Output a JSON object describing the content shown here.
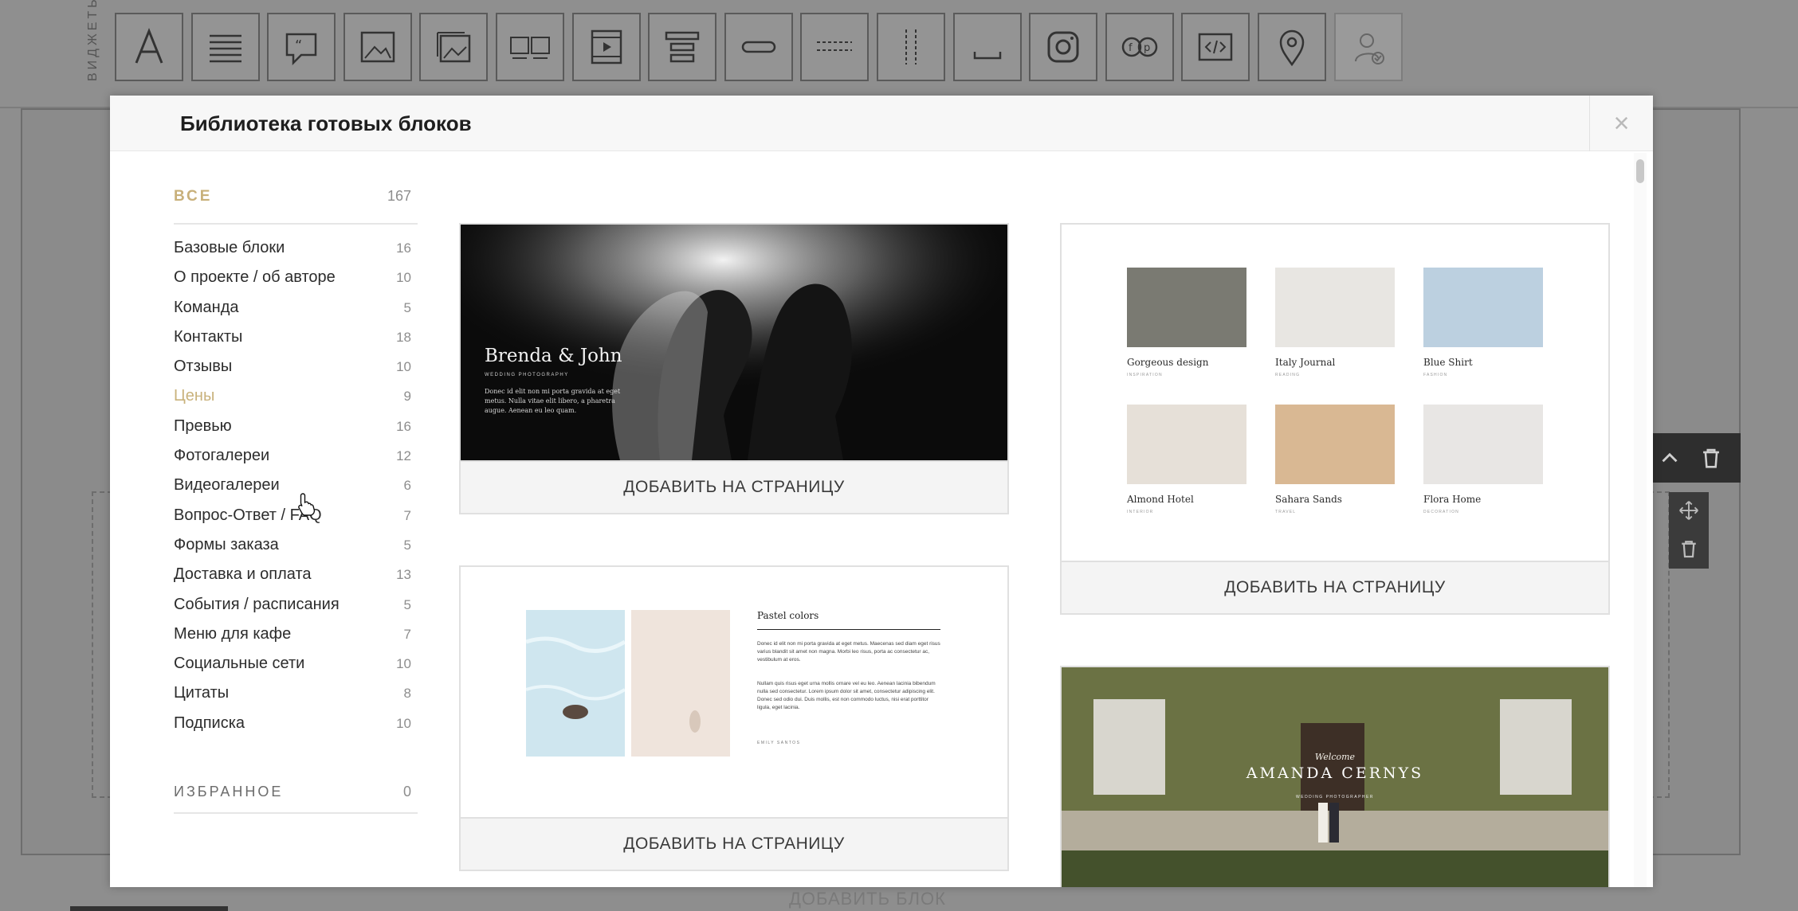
{
  "widget_bar": {
    "label": "ВИДЖЕТЫ",
    "tiles": [
      {
        "icon": "text-a-icon"
      },
      {
        "icon": "paragraph-icon"
      },
      {
        "icon": "quote-icon"
      },
      {
        "icon": "image-icon"
      },
      {
        "icon": "gallery-icon"
      },
      {
        "icon": "image-row-icon"
      },
      {
        "icon": "video-icon"
      },
      {
        "icon": "layout-blocks-icon"
      },
      {
        "icon": "button-icon"
      },
      {
        "icon": "divider-dashed-icon"
      },
      {
        "icon": "vertical-divider-icon"
      },
      {
        "icon": "spacer-icon"
      },
      {
        "icon": "instagram-icon"
      },
      {
        "icon": "social-icon"
      },
      {
        "icon": "code-icon"
      },
      {
        "icon": "map-pin-icon"
      },
      {
        "icon": "user-check-icon"
      }
    ]
  },
  "bottom": {
    "add_block_label": "ДОБАВИТЬ БЛОК"
  },
  "modal": {
    "title": "Библиотека готовых блоков",
    "close_label": "×",
    "all": {
      "label": "ВСЕ",
      "count": "167"
    },
    "categories": [
      {
        "label": "Базовые блоки",
        "count": "16"
      },
      {
        "label": "О проекте / об авторе",
        "count": "10"
      },
      {
        "label": "Команда",
        "count": "5"
      },
      {
        "label": "Контакты",
        "count": "18"
      },
      {
        "label": "Отзывы",
        "count": "10"
      },
      {
        "label": "Цены",
        "count": "9"
      },
      {
        "label": "Превью",
        "count": "16"
      },
      {
        "label": "Фотогалереи",
        "count": "12"
      },
      {
        "label": "Видеогалереи",
        "count": "6"
      },
      {
        "label": "Вопрос-Ответ / FAQ",
        "count": "7"
      },
      {
        "label": "Формы заказа",
        "count": "5"
      },
      {
        "label": "Доставка и оплата",
        "count": "13"
      },
      {
        "label": "События / расписания",
        "count": "5"
      },
      {
        "label": "Меню для кафе",
        "count": "7"
      },
      {
        "label": "Социальные сети",
        "count": "10"
      },
      {
        "label": "Цитаты",
        "count": "8"
      },
      {
        "label": "Подписка",
        "count": "10"
      }
    ],
    "favorites": {
      "label": "ИЗБРАННОЕ",
      "count": "0"
    },
    "add_label": "ДОБАВИТЬ НА СТРАНИЦУ",
    "cards": {
      "c1": {
        "title": "Brenda & John",
        "subtitle": "WEDDING PHOTOGRAPHY",
        "body": "Donec id elit non mi porta gravida at eget metus. Nulla vitae elit libero, a pharetra augue. Aenean eu leo quam."
      },
      "c2": {
        "items": [
          {
            "title": "Gorgeous design",
            "tag": "INSPIRATION"
          },
          {
            "title": "Italy Journal",
            "tag": "READING"
          },
          {
            "title": "Blue Shirt",
            "tag": "FASHION"
          },
          {
            "title": "Almond Hotel",
            "tag": "INTERIOR"
          },
          {
            "title": "Sahara Sands",
            "tag": "TRAVEL"
          },
          {
            "title": "Flora Home",
            "tag": "DECORATION"
          }
        ]
      },
      "c3": {
        "title": "Pastel colors",
        "text1": "Donec id elit non mi porta gravida at eget metus. Maecenas sed diam eget risus varius blandit sit amet non magna. Morbi leo risus, porta ac consectetur ac, vestibulum at eros.",
        "text2": "Nullam quis risus eget urna mollis ornare vel eu leo. Aenean lacinia bibendum nulla sed consectetur. Lorem ipsum dolor sit amet, consectetur adipiscing elit. Donec sed odio dui. Duis mollis, est non commodo luctus, nisi erat porttitor ligula, eget lacinia.",
        "author": "EMILY SANTOS"
      },
      "c4": {
        "welcome": "Welcome",
        "name": "AMANDA CERNYS",
        "subtitle": "WEDDING PHOTOGRAPHER"
      }
    }
  }
}
